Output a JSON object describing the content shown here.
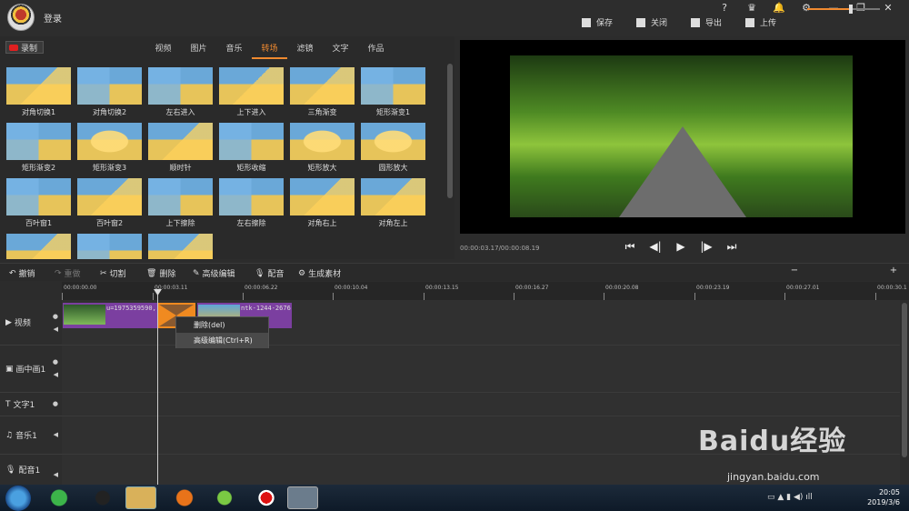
{
  "topbar": {
    "login": "登录",
    "sys_icons": [
      "?",
      "VIP",
      "bell",
      "gear",
      "—",
      "❐",
      "✕"
    ],
    "actions": [
      {
        "label": "保存",
        "icon": "save-icon"
      },
      {
        "label": "关闭",
        "icon": "close-doc-icon"
      },
      {
        "label": "导出",
        "icon": "export-icon"
      },
      {
        "label": "上传",
        "icon": "upload-icon"
      }
    ]
  },
  "library": {
    "record_label": "录制",
    "tabs": [
      "视频",
      "图片",
      "音乐",
      "转场",
      "滤镜",
      "文字",
      "作品"
    ],
    "active_tab": "转场",
    "items": [
      "对角切换1",
      "对角切换2",
      "左右进入",
      "上下进入",
      "三角渐变",
      "矩形渐变1",
      "矩形渐变2",
      "矩形渐变3",
      "顺时针",
      "矩形收缩",
      "矩形放大",
      "圆形放大",
      "百叶窗1",
      "百叶窗2",
      "上下擦除",
      "左右擦除",
      "对角右上",
      "对角左上",
      "",
      "",
      ""
    ]
  },
  "preview": {
    "time": "00:00:03.17/00:00:08.19",
    "controls": [
      "⏮",
      "◀|",
      "▶",
      "|▶",
      "⏭"
    ]
  },
  "toolbar": {
    "undo": "撤销",
    "redo": "重做",
    "cut": "切割",
    "delete": "删除",
    "advanced": "高级编辑",
    "dub": "配音",
    "generate": "生成素材",
    "zoom_out": "−",
    "zoom_in": "+"
  },
  "ruler": [
    "00:00:00.00",
    "00:00:03.11",
    "00:00:06.22",
    "00:00:10.04",
    "00:00:13.15",
    "00:00:16.27",
    "00:00:20.08",
    "00:00:23.19",
    "00:00:27.01",
    "00:00:30.1"
  ],
  "tracks": [
    {
      "label": "视频",
      "icon": "video-track-icon"
    },
    {
      "label": "画中画1",
      "icon": "pip-track-icon"
    },
    {
      "label": "文字1",
      "icon": "text-track-icon"
    },
    {
      "label": "音乐1",
      "icon": "music-track-icon"
    },
    {
      "label": "配音1",
      "icon": "mic-track-icon"
    }
  ],
  "clips": {
    "clip1": "u=1975359590,",
    "clip2": "ntk-1244-2676"
  },
  "context_menu": {
    "delete": "删除(del)",
    "advanced": "高级编辑(Ctrl+R)"
  },
  "watermark": {
    "main": "Baidu经验",
    "url": "jingyan.baidu.com"
  },
  "taskbar": {
    "time": "20:05",
    "date": "2019/3/6"
  },
  "colors": {
    "accent": "#f08a30",
    "clip": "#7b3fa0",
    "record": "#e02020"
  }
}
